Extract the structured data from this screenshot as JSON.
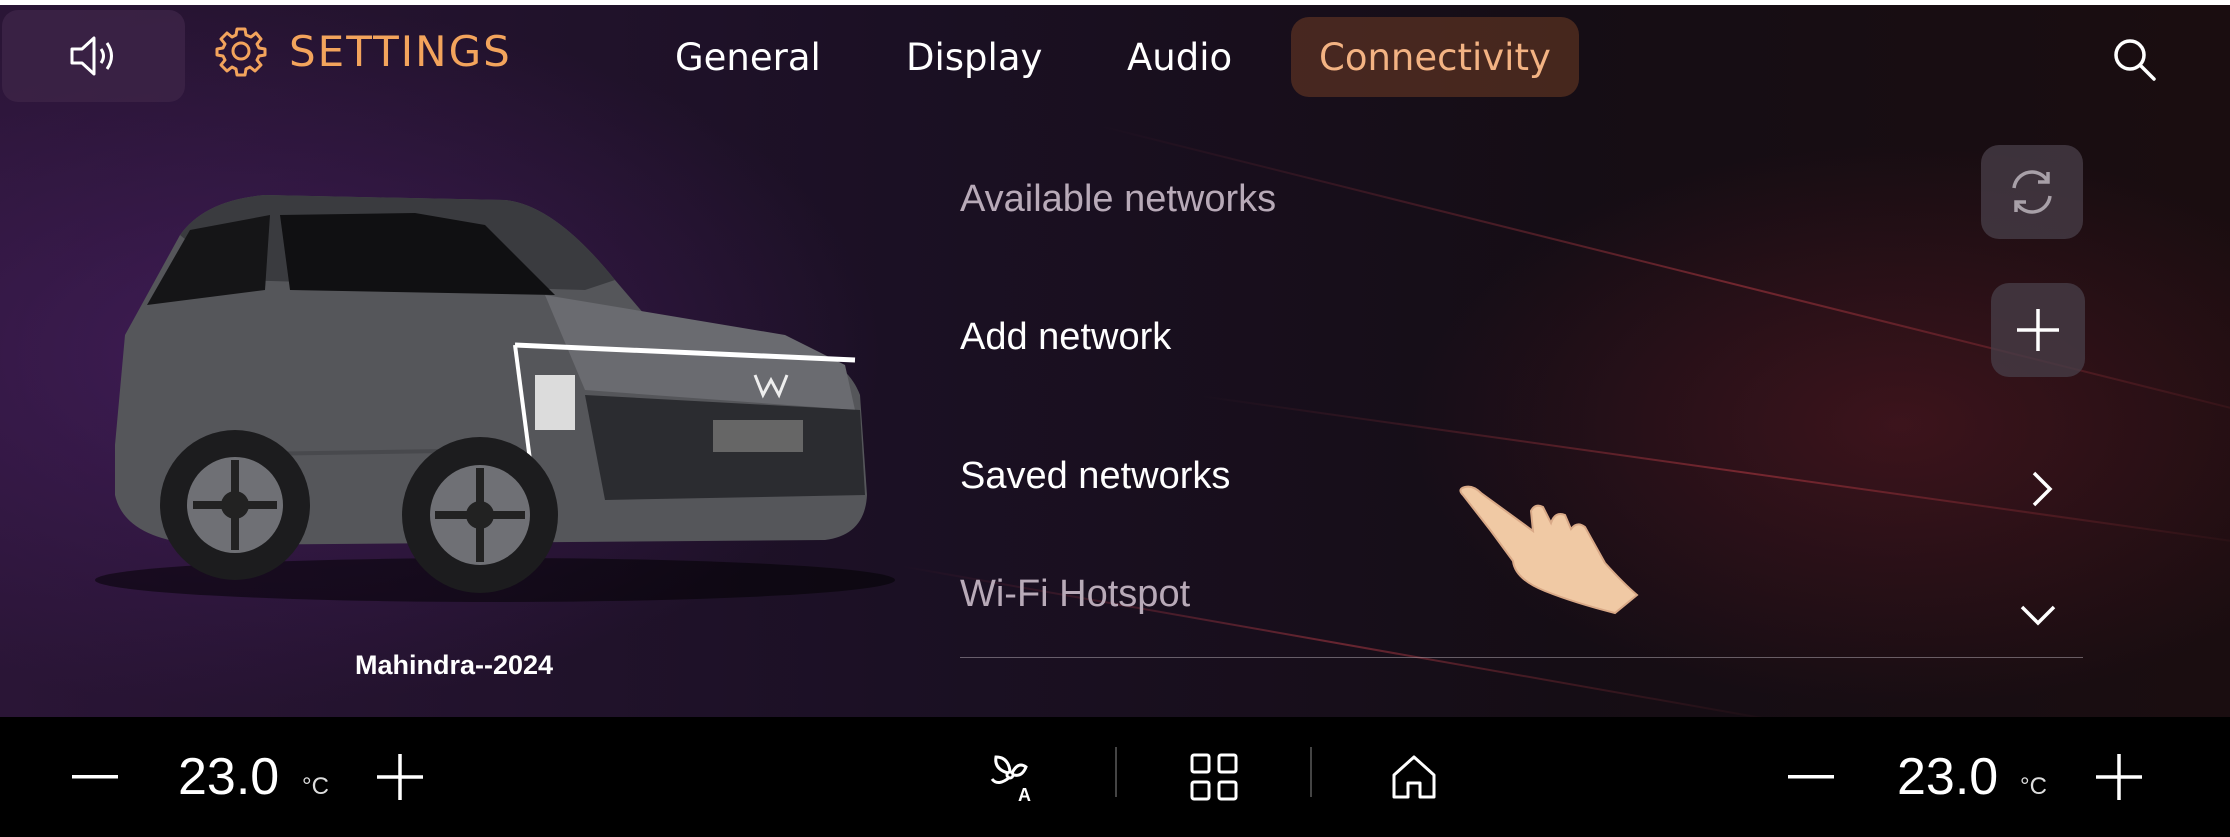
{
  "header": {
    "title": "SETTINGS",
    "tabs": [
      {
        "label": "General",
        "active": false
      },
      {
        "label": "Display",
        "active": false
      },
      {
        "label": "Audio",
        "active": false
      },
      {
        "label": "Connectivity",
        "active": true
      }
    ],
    "icons": {
      "volume": "speaker-icon",
      "settings": "gear-icon",
      "search": "search-icon"
    }
  },
  "vehicle": {
    "name": "Mahindra--2024"
  },
  "networks": {
    "available_label": "Available networks",
    "add_label": "Add network",
    "saved_label": "Saved networks",
    "hotspot_label": "Wi-Fi Hotspot"
  },
  "climate": {
    "left": {
      "temp": "23.0",
      "unit": "°C"
    },
    "right": {
      "temp": "23.0",
      "unit": "°C"
    }
  },
  "colors": {
    "accent": "#f3a45c",
    "active_tab_text": "#f3b383"
  }
}
